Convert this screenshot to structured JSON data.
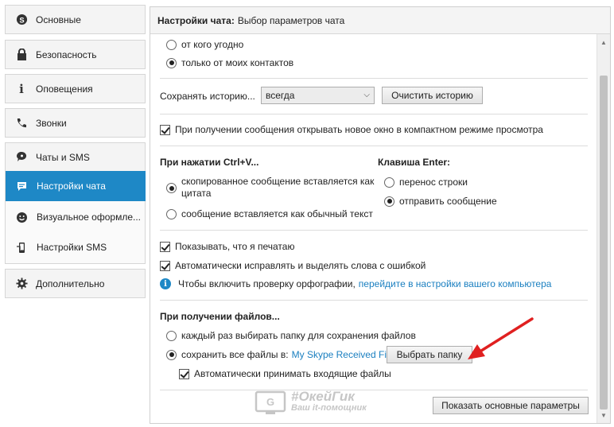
{
  "sidebar": {
    "items": [
      {
        "label": "Основные",
        "icon": "skype-icon"
      },
      {
        "label": "Безопасность",
        "icon": "lock-icon"
      },
      {
        "label": "Оповещения",
        "icon": "info-icon"
      },
      {
        "label": "Звонки",
        "icon": "phone-icon"
      },
      {
        "label": "Чаты и SMS",
        "icon": "chat-icon"
      }
    ],
    "subitems": [
      {
        "label": "Настройки чата",
        "icon": "chat-bubble-icon",
        "active": true
      },
      {
        "label": "Визуальное оформле...",
        "icon": "smiley-icon"
      },
      {
        "label": "Настройки SMS",
        "icon": "mobile-icon"
      }
    ],
    "extra": {
      "label": "Дополнительно",
      "icon": "gear-icon"
    }
  },
  "header": {
    "bold": "Настройки чата:",
    "rest": "Выбор параметров чата"
  },
  "content": {
    "radio_anyone": "от кого угодно",
    "radio_contacts": "только от моих контактов",
    "history_label": "Сохранять историю...",
    "history_value": "всегда",
    "clear_history_button": "Очистить историю",
    "compact_window_check": "При получении сообщения открывать новое окно в компактном режиме просмотра",
    "ctrlv_title": "При нажатии Ctrl+V...",
    "ctrlv_opt1_line1": "скопированное сообщение вставляется как",
    "ctrlv_opt1_line2": "цитата",
    "ctrlv_opt2": "сообщение вставляется как обычный текст",
    "enter_title": "Клавиша Enter:",
    "enter_opt1": "перенос строки",
    "enter_opt2": "отправить сообщение",
    "typing_check": "Показывать, что я печатаю",
    "autocorrect_check": "Автоматически исправлять и выделять слова с ошибкой",
    "spell_info_text": "Чтобы включить проверку орфографии,",
    "spell_info_link": "перейдите в настройки вашего компьютера",
    "files_title": "При получении файлов...",
    "files_opt1": "каждый раз выбирать папку для сохранения файлов",
    "files_opt2": "сохранить все файлы в:",
    "files_folder_link": "My Skype Received Files",
    "choose_folder_button": "Выбрать папку",
    "auto_accept_check": "Автоматически принимать входящие файлы",
    "show_basic_button": "Показать основные параметры"
  },
  "watermark": {
    "line1": "#ОкейГик",
    "line2": "Ваш it-помощник"
  },
  "colors": {
    "accent": "#1e88c6",
    "arrow": "#e02020",
    "link": "#1a7fc0"
  }
}
